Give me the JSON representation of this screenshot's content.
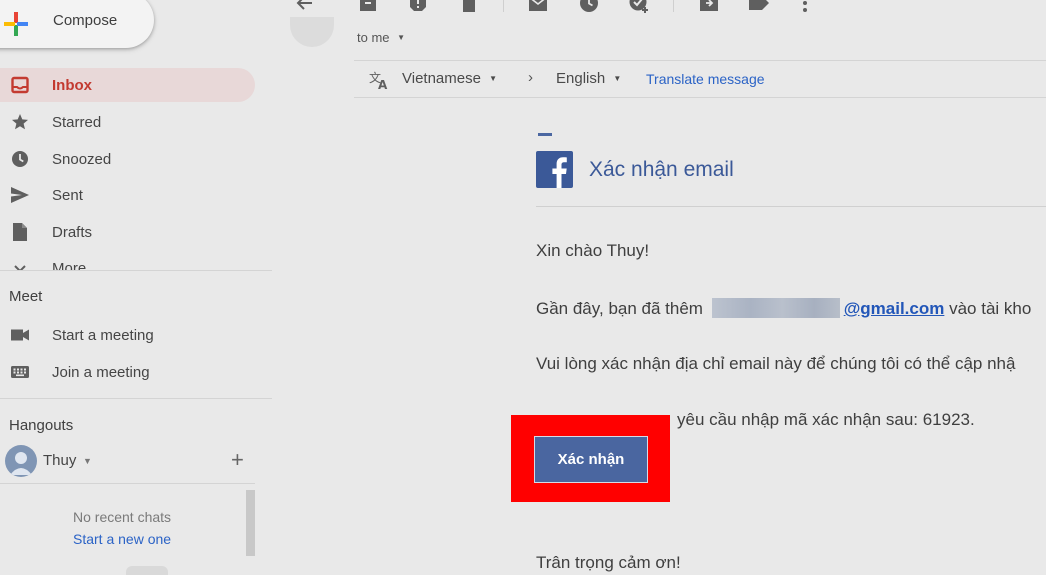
{
  "compose": {
    "label": "Compose"
  },
  "nav": {
    "items": [
      {
        "label": "Inbox",
        "icon": "inbox-icon",
        "active": true
      },
      {
        "label": "Starred",
        "icon": "star-icon"
      },
      {
        "label": "Snoozed",
        "icon": "clock-icon"
      },
      {
        "label": "Sent",
        "icon": "send-icon"
      },
      {
        "label": "Drafts",
        "icon": "draft-icon"
      },
      {
        "label": "More",
        "icon": "chevron-down-icon"
      }
    ]
  },
  "meet": {
    "title": "Meet",
    "start_label": "Start a meeting",
    "join_label": "Join a meeting"
  },
  "hangouts": {
    "title": "Hangouts",
    "user_name": "Thuy",
    "no_chats": "No recent chats",
    "start_new": "Start a new one"
  },
  "toolbar": {
    "icons": [
      "back-arrow-icon",
      "archive-icon",
      "report-spam-icon",
      "delete-icon",
      "mark-unread-icon",
      "snooze-icon",
      "add-task-icon",
      "move-to-icon",
      "label-icon",
      "more-vert-icon"
    ]
  },
  "email": {
    "recipient": "to me",
    "translate": {
      "from_lang": "Vietnamese",
      "to_lang": "English",
      "link": "Translate message"
    },
    "title": "Xác nhận email",
    "greeting": "Xin chào Thuy!",
    "line1_before": "Gần đây, bạn đã thêm",
    "line1_email": "@gmail.com",
    "line1_after": "vào tài kho",
    "line2": "Vui lòng xác nhận địa chỉ email này để chúng tôi có thể cập nhậ",
    "line3_visible": "yêu cầu nhập mã xác nhận sau: 61923.",
    "confirm_button": "Xác nhận",
    "closing": "Trân trọng cảm ơn!"
  },
  "colors": {
    "facebook_blue": "#3b5998",
    "inbox_red": "#c33a30",
    "highlight": "#ff0000",
    "link_blue": "#2b63c6"
  }
}
